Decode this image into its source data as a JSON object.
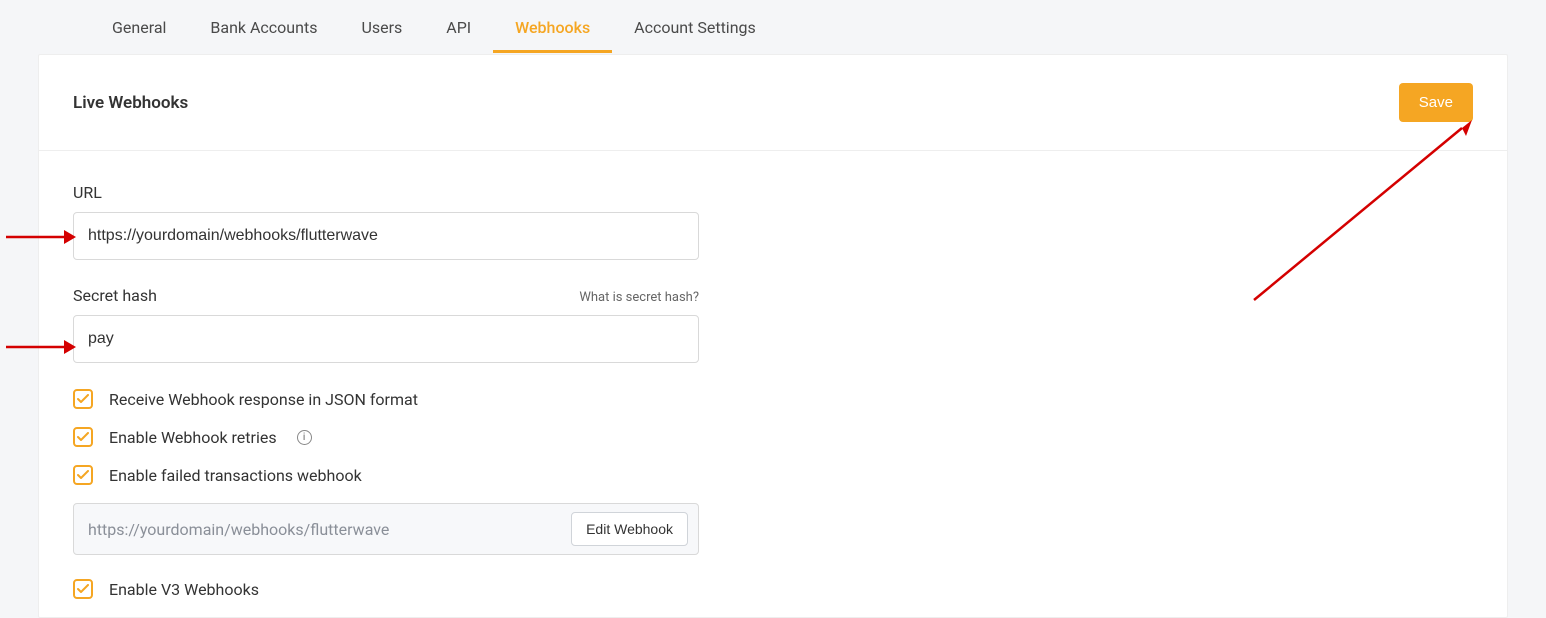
{
  "tabs": [
    {
      "label": "General"
    },
    {
      "label": "Bank Accounts"
    },
    {
      "label": "Users"
    },
    {
      "label": "API"
    },
    {
      "label": "Webhooks",
      "active": true
    },
    {
      "label": "Account Settings"
    }
  ],
  "header": {
    "title": "Live Webhooks",
    "save_label": "Save"
  },
  "form": {
    "url_label": "URL",
    "url_value": "https://yourdomain/webhooks/flutterwave",
    "secret_label": "Secret hash",
    "secret_hint": "What is secret hash?",
    "secret_value": "pay",
    "checkbox_json": "Receive Webhook response in JSON format",
    "checkbox_retries": "Enable Webhook retries",
    "checkbox_failed": "Enable failed transactions webhook",
    "readonly_url": "https://yourdomain/webhooks/flutterwave",
    "edit_webhook_label": "Edit Webhook",
    "checkbox_v3": "Enable V3 Webhooks"
  },
  "colors": {
    "accent": "#f5a623"
  }
}
